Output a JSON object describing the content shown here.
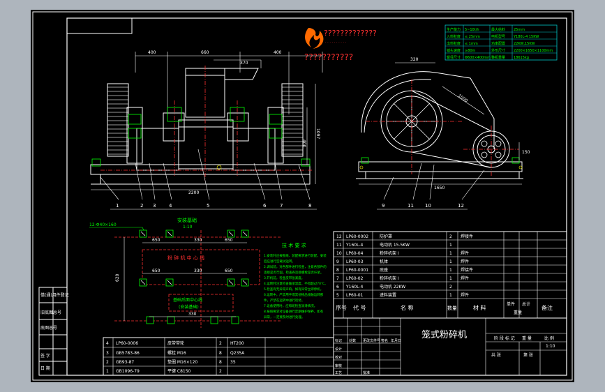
{
  "viewport": {
    "background": "#aeb5bd",
    "canvas_background": "#000000"
  },
  "colors": {
    "line": "#ffffff",
    "green": "#00ff00",
    "red": "#ff3030",
    "cyan": "#00c8c8",
    "yellow": "#ffff00",
    "magenta": "#ff40ff",
    "logo": "#ff6a00"
  },
  "logo": {
    "text": "?????????????",
    "subtitle": "???????????"
  },
  "front_view": {
    "dims": {
      "top_left": "400",
      "top_mid": "660",
      "top_right": "400",
      "top_small": "370",
      "right_a": "1097",
      "right_b": "400",
      "bottom": "2200"
    },
    "callouts": [
      "1",
      "2",
      "3",
      "4",
      "5",
      "6",
      "7",
      "8"
    ]
  },
  "side_view": {
    "dims": {
      "top": "320",
      "diag": "1000",
      "bottom": "1650",
      "right": "150"
    },
    "callouts": [
      "9",
      "11",
      "10",
      "12"
    ]
  },
  "plan_view": {
    "title": "安装基础",
    "subtitle": "1:10",
    "hole_note": "12-Φ40×160",
    "label_frame": "粉 碎 机 中 心 线",
    "label_center": "基础后面中心线",
    "label_section": "(安装基础)",
    "dims": {
      "a": "650",
      "b": "330",
      "c": "650",
      "d": "650",
      "e": "330",
      "f": "650",
      "g": "330",
      "left": "620"
    }
  },
  "spec_table": {
    "rows": [
      [
        "生产能力",
        "5~10t/h",
        "最大给料",
        "25mm"
      ],
      [
        "入料粒度",
        "≤ 25mm",
        "电机型号",
        "Y180L-4 15KW"
      ],
      [
        "出料粒度",
        "≤ 1mm",
        "功率配置",
        "22KW,15KW"
      ],
      [
        "锤头速度",
        "≥80m",
        "外形尺寸",
        "2200×1650×1100mm"
      ],
      [
        "辊径尺寸",
        "Φ600×400mm",
        "整机重量",
        "18615kg"
      ]
    ]
  },
  "tech_requirements": {
    "title": "技 术 要 求",
    "lines": [
      "1.安装时应按图纸、装配要求进行装配，安装",
      "后应进行空载试运转。",
      "2.调试前，对各部件进行检查，注意各部件的",
      "连接是否牢固，检查各连接螺栓是否拧紧。",
      "3.开机前，检查皮带张紧度。",
      "4.运转时注意检查轴承温度，不得超过70℃。",
      "5.检查有无异常声响，如有异常立即停机。",
      "6.运转中，严禁用手或其他物品接触运转部",
      "件，严禁在运转中进行检修。",
      "7.设备使用时，应每班检查润滑情况。",
      "8.按照要求对设备进行定期维护保养，如有",
      "异常，一定要及时进行处理。"
    ]
  },
  "parts_list": {
    "rows": [
      [
        "12",
        "LP60-0002",
        "防护罩",
        "2",
        "焊接件"
      ],
      [
        "11",
        "Y160L-4",
        "电动机 15.5KW",
        "1",
        ""
      ],
      [
        "10",
        "LP60-04",
        "粉碎机架 I",
        "1",
        "焊件"
      ],
      [
        "9",
        "LP60-03",
        "机体",
        "1",
        "焊件"
      ],
      [
        "8",
        "LP60-0001",
        "底座",
        "1",
        "焊接件"
      ],
      [
        "7",
        "LP60-02",
        "粉碎机架 I",
        "1",
        "焊件"
      ],
      [
        "6",
        "Y160L-4",
        "电动机 22KW",
        "2",
        ""
      ],
      [
        "5",
        "LP60-01",
        "进料装置",
        "1",
        "焊件"
      ]
    ],
    "header": [
      "序号",
      "代 号",
      "名 称",
      "数量",
      "材 料",
      "单件",
      "总计",
      "备注"
    ],
    "header_sub": "重量",
    "lower_rows": [
      [
        "4",
        "LP60-0006",
        "皮带带轮",
        "2",
        "HT200"
      ],
      [
        "3",
        "GB5783-86",
        "螺栓 M16",
        "8",
        "Q235A"
      ],
      [
        "2",
        "GB93-87",
        "垫圈 M16×120",
        "8",
        "35"
      ],
      [
        "1",
        "GB1096-79",
        "平键 C8150",
        "2",
        ""
      ]
    ]
  },
  "title_block": {
    "name": "笼式粉碎机",
    "stage_label": "阶 段 标 记",
    "weight_label": "重 量",
    "scale_label": "比 例",
    "scale": "1:10",
    "sheet_label": "共 张",
    "sheet2_label": "第 张",
    "sign": [
      "标记",
      "处数",
      "更改文件号",
      "签名",
      "年月日"
    ],
    "roles": [
      "设计",
      "校对",
      "审核",
      "工艺",
      "批准"
    ]
  },
  "left_strip": {
    "labels": [
      "借(通)用件登记",
      "旧底图总号",
      "底图总号",
      "签 字",
      "日 期"
    ]
  }
}
